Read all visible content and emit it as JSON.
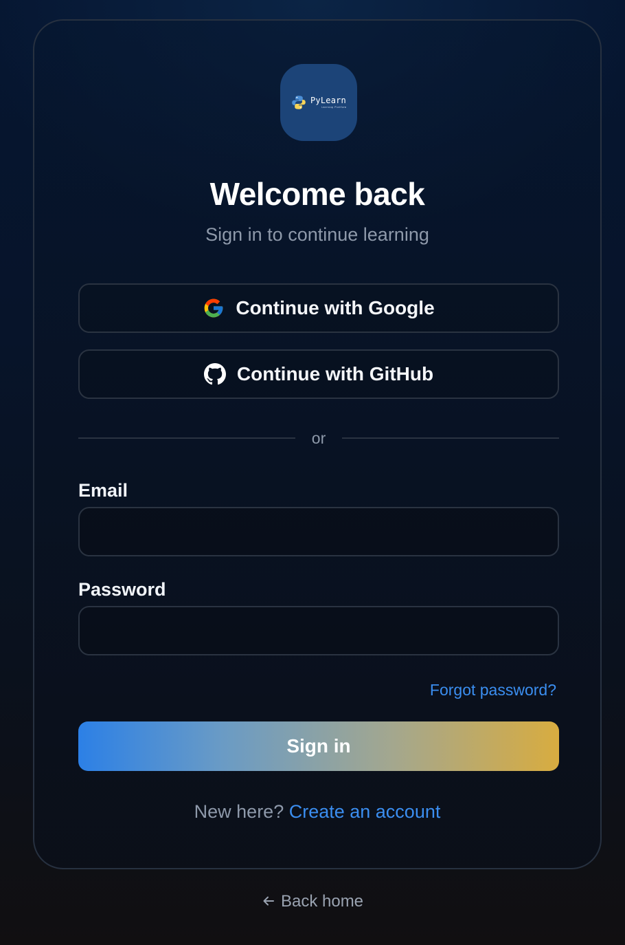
{
  "brand": {
    "name": "PyLearn",
    "tagline": "Learning Platform",
    "logo_icon": "python-logo-icon",
    "logo_bg": "#1c4478"
  },
  "header": {
    "title": "Welcome back",
    "subtitle": "Sign in to continue learning"
  },
  "oauth": {
    "google_label": "Continue with Google",
    "google_icon": "google-icon",
    "github_label": "Continue with GitHub",
    "github_icon": "github-icon"
  },
  "divider": {
    "text": "or"
  },
  "form": {
    "email_label": "Email",
    "email_value": "",
    "email_placeholder": "",
    "password_label": "Password",
    "password_value": "",
    "password_placeholder": "",
    "forgot_label": "Forgot password?",
    "submit_label": "Sign in"
  },
  "signup": {
    "prompt": "New here?",
    "link_label": "Create an account"
  },
  "footer": {
    "back_icon": "arrow-left-icon",
    "back_label": "Back home"
  },
  "colors": {
    "accent_blue": "#3b8ef0",
    "gradient_start": "#2c80e6",
    "gradient_end": "#d8ac40",
    "muted_text": "#8e99aa",
    "border": "#2a3341"
  }
}
